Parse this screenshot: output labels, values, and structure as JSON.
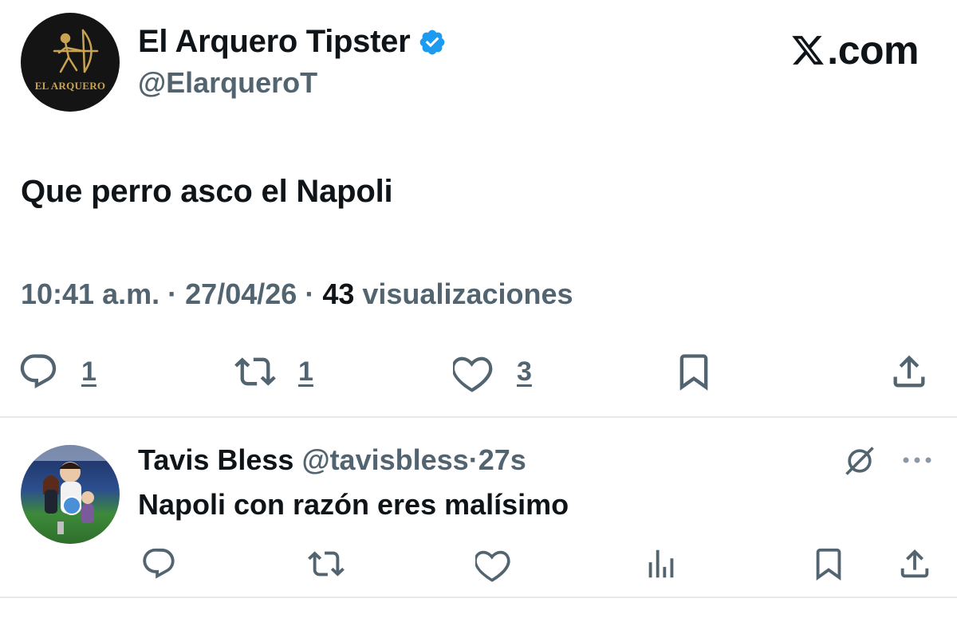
{
  "main_tweet": {
    "avatar_text": "EL ARQUERO",
    "display_name": "El Arquero Tipster",
    "handle": "@ElarqueroT",
    "brand": ".com",
    "text": "Que perro asco el Napoli",
    "time": "10:41 a.m.",
    "date": "27/04/26",
    "views_count": "43",
    "views_label": "visualizaciones",
    "separator": "·",
    "replies": "1",
    "retweets": "1",
    "likes": "3"
  },
  "reply": {
    "display_name": "Tavis Bless",
    "handle": "@tavisbless",
    "separator": "·",
    "time": "27s",
    "text": "Napoli con razón eres malísimo"
  },
  "colors": {
    "primary_text": "#0f1419",
    "secondary_text": "#536471",
    "verified_blue": "#1d9bf0",
    "divider": "#e7e9ea",
    "logo_gold": "#c9a352"
  },
  "icons": [
    "verified-badge-icon",
    "x-logo-icon",
    "reply-icon",
    "retweet-icon",
    "like-icon",
    "bookmark-icon",
    "share-icon",
    "grok-icon",
    "more-icon",
    "views-icon"
  ]
}
